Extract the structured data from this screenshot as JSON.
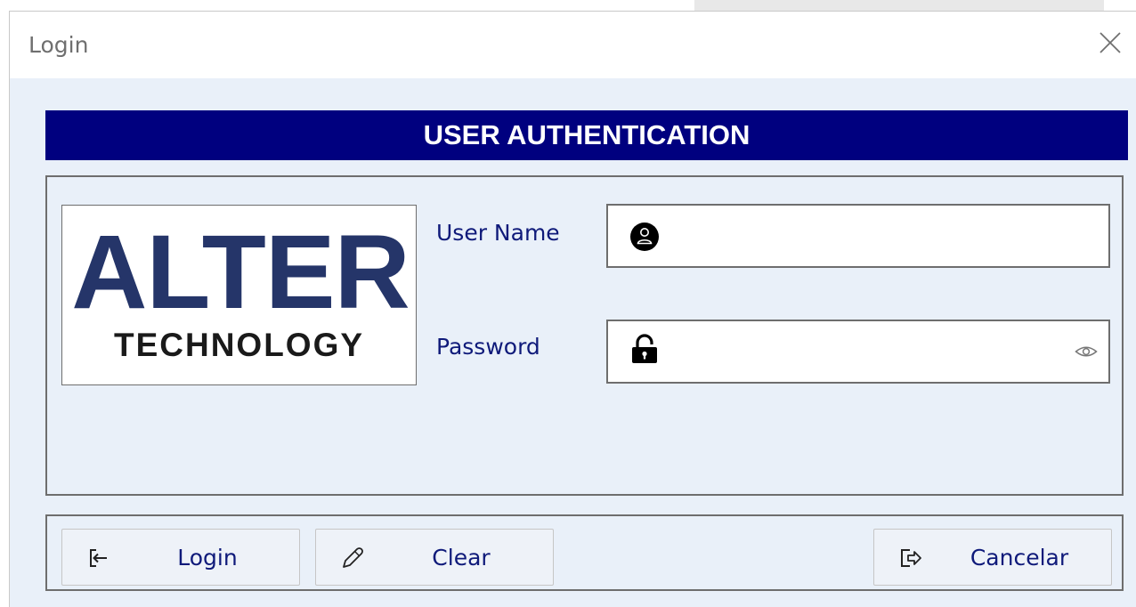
{
  "window": {
    "title": "Login"
  },
  "header": {
    "title": "USER AUTHENTICATION"
  },
  "logo": {
    "main_text": "ALTER",
    "sub_text": "TECHNOLOGY",
    "brand_color": "#253569"
  },
  "form": {
    "username": {
      "label": "User Name",
      "value": "",
      "icon": "user-icon"
    },
    "password": {
      "label": "Password",
      "value": "",
      "icon": "lock-icon",
      "toggle_icon": "eye-icon"
    }
  },
  "buttons": {
    "login": {
      "label": "Login",
      "icon": "login-icon"
    },
    "clear": {
      "label": "Clear",
      "icon": "pencil-icon"
    },
    "cancel": {
      "label": "Cancelar",
      "icon": "logout-icon"
    }
  },
  "colors": {
    "header_bg": "#00007f",
    "window_bg": "#e9f0f9",
    "label_text": "#0f1a7a"
  }
}
